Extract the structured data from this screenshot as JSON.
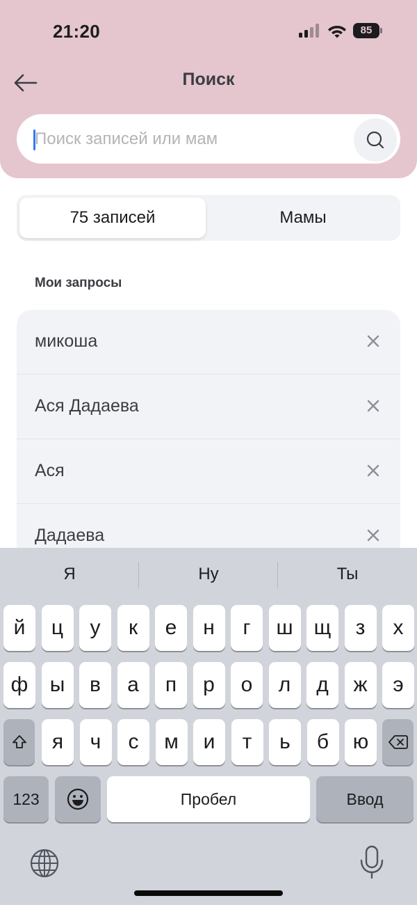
{
  "status_bar": {
    "time": "21:20",
    "battery": "85"
  },
  "header": {
    "title": "Поиск"
  },
  "search": {
    "placeholder": "Поиск записей или мам",
    "value": ""
  },
  "tabs": [
    {
      "label": "75 записей",
      "selected": true
    },
    {
      "label": "Мамы",
      "selected": false
    }
  ],
  "recent": {
    "title": "Мои запросы",
    "items": [
      "микоша",
      "Ася Дадаева",
      "Ася",
      "Дадаева"
    ]
  },
  "keyboard": {
    "suggestions": [
      "Я",
      "Ну",
      "Ты"
    ],
    "row1": [
      "й",
      "ц",
      "у",
      "к",
      "е",
      "н",
      "г",
      "ш",
      "щ",
      "з",
      "х"
    ],
    "row2": [
      "ф",
      "ы",
      "в",
      "а",
      "п",
      "р",
      "о",
      "л",
      "д",
      "ж",
      "э"
    ],
    "row3": [
      "я",
      "ч",
      "с",
      "м",
      "и",
      "т",
      "ь",
      "б",
      "ю"
    ],
    "numbers_label": "123",
    "space_label": "Пробел",
    "enter_label": "Ввод"
  },
  "colors": {
    "header_bg": "#e5c6ce",
    "accent_caret": "#3478f6",
    "keyboard_bg": "#d1d4db"
  }
}
